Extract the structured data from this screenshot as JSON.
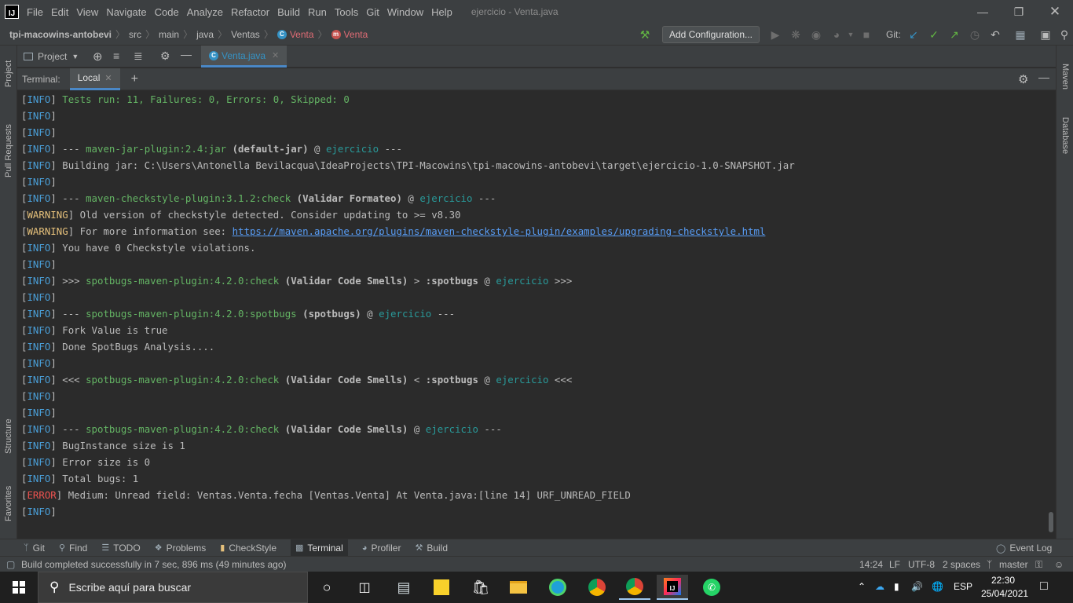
{
  "menubar": {
    "items": [
      "File",
      "Edit",
      "View",
      "Navigate",
      "Code",
      "Analyze",
      "Refactor",
      "Build",
      "Run",
      "Tools",
      "Git",
      "Window",
      "Help"
    ],
    "window_title": "ejercicio - Venta.java"
  },
  "breadcrumb": {
    "project": "tpi-macowins-antobevi",
    "parts": [
      "src",
      "main",
      "java",
      "Ventas"
    ],
    "class_name": "Venta",
    "method_name": "Venta"
  },
  "toolbar": {
    "add_configuration": "Add Configuration...",
    "git_label": "Git:"
  },
  "left_stripe": {
    "project": "Project",
    "pull_requests": "Pull Requests",
    "structure": "Structure",
    "favorites": "Favorites"
  },
  "right_stripe": {
    "maven": "Maven",
    "database": "Database"
  },
  "project_panel": {
    "label": "Project"
  },
  "editor": {
    "tab_label": "Venta.java"
  },
  "terminal": {
    "label": "Terminal:",
    "tab": "Local",
    "lines": [
      {
        "lvl": "INFO",
        "parts": [
          {
            "t": " "
          },
          {
            "t": "Tests run: 11, Failures: 0, Errors: 0, Skipped: 0",
            "c": "green"
          }
        ]
      },
      {
        "lvl": "INFO",
        "parts": []
      },
      {
        "lvl": "INFO",
        "parts": []
      },
      {
        "lvl": "INFO",
        "parts": [
          {
            "t": " --- "
          },
          {
            "t": "maven-jar-plugin:2.4:jar",
            "c": "green"
          },
          {
            "t": " (default-jar)",
            "c": "bold"
          },
          {
            "t": " @ "
          },
          {
            "t": "ejercicio",
            "c": "cyan"
          },
          {
            "t": " ---"
          }
        ]
      },
      {
        "lvl": "INFO",
        "parts": [
          {
            "t": " Building jar: C:\\Users\\Antonella Bevilacqua\\IdeaProjects\\TPI-Macowins\\tpi-macowins-antobevi\\target\\ejercicio-1.0-SNAPSHOT.jar"
          }
        ]
      },
      {
        "lvl": "INFO",
        "parts": []
      },
      {
        "lvl": "INFO",
        "parts": [
          {
            "t": " --- "
          },
          {
            "t": "maven-checkstyle-plugin:3.1.2:check",
            "c": "green"
          },
          {
            "t": " (Validar Formateo)",
            "c": "bold"
          },
          {
            "t": " @ "
          },
          {
            "t": "ejercicio",
            "c": "cyan"
          },
          {
            "t": " ---"
          }
        ]
      },
      {
        "lvl": "WARNING",
        "parts": [
          {
            "t": " Old version of checkstyle detected. Consider updating to >= v8.30"
          }
        ]
      },
      {
        "lvl": "WARNING",
        "parts": [
          {
            "t": " For more information see: "
          },
          {
            "t": "https://maven.apache.org/plugins/maven-checkstyle-plugin/examples/upgrading-checkstyle.html",
            "c": "link"
          }
        ]
      },
      {
        "lvl": "INFO",
        "parts": [
          {
            "t": " You have 0 Checkstyle violations."
          }
        ]
      },
      {
        "lvl": "INFO",
        "parts": []
      },
      {
        "lvl": "INFO",
        "parts": [
          {
            "t": " >>> "
          },
          {
            "t": "spotbugs-maven-plugin:4.2.0:check",
            "c": "green"
          },
          {
            "t": " (Validar Code Smells)",
            "c": "bold"
          },
          {
            "t": " > "
          },
          {
            "t": ":spotbugs",
            "c": "bold"
          },
          {
            "t": " @ "
          },
          {
            "t": "ejercicio",
            "c": "cyan"
          },
          {
            "t": " >>>"
          }
        ]
      },
      {
        "lvl": "INFO",
        "parts": []
      },
      {
        "lvl": "INFO",
        "parts": [
          {
            "t": " --- "
          },
          {
            "t": "spotbugs-maven-plugin:4.2.0:spotbugs",
            "c": "green"
          },
          {
            "t": " (spotbugs)",
            "c": "bold"
          },
          {
            "t": " @ "
          },
          {
            "t": "ejercicio",
            "c": "cyan"
          },
          {
            "t": " ---"
          }
        ]
      },
      {
        "lvl": "INFO",
        "parts": [
          {
            "t": " Fork Value is true"
          }
        ]
      },
      {
        "lvl": "INFO",
        "parts": [
          {
            "t": " Done SpotBugs Analysis...."
          }
        ]
      },
      {
        "lvl": "INFO",
        "parts": []
      },
      {
        "lvl": "INFO",
        "parts": [
          {
            "t": " <<< "
          },
          {
            "t": "spotbugs-maven-plugin:4.2.0:check",
            "c": "green"
          },
          {
            "t": " (Validar Code Smells)",
            "c": "bold"
          },
          {
            "t": " < "
          },
          {
            "t": ":spotbugs",
            "c": "bold"
          },
          {
            "t": " @ "
          },
          {
            "t": "ejercicio",
            "c": "cyan"
          },
          {
            "t": " <<<"
          }
        ]
      },
      {
        "lvl": "INFO",
        "parts": []
      },
      {
        "lvl": "INFO",
        "parts": []
      },
      {
        "lvl": "INFO",
        "parts": [
          {
            "t": " --- "
          },
          {
            "t": "spotbugs-maven-plugin:4.2.0:check",
            "c": "green"
          },
          {
            "t": " (Validar Code Smells)",
            "c": "bold"
          },
          {
            "t": " @ "
          },
          {
            "t": "ejercicio",
            "c": "cyan"
          },
          {
            "t": " ---"
          }
        ]
      },
      {
        "lvl": "INFO",
        "parts": [
          {
            "t": " BugInstance size is 1"
          }
        ]
      },
      {
        "lvl": "INFO",
        "parts": [
          {
            "t": " Error size is 0"
          }
        ]
      },
      {
        "lvl": "INFO",
        "parts": [
          {
            "t": " Total bugs: 1"
          }
        ]
      },
      {
        "lvl": "ERROR",
        "parts": [
          {
            "t": " Medium: Unread field: Ventas.Venta.fecha [Ventas.Venta] At Venta.java:[line 14] URF_UNREAD_FIELD"
          }
        ]
      },
      {
        "lvl": "INFO",
        "parts": []
      }
    ]
  },
  "bottom_tabs": [
    "Git",
    "Find",
    "TODO",
    "Problems",
    "CheckStyle",
    "Terminal",
    "Profiler",
    "Build"
  ],
  "bottom_tab_icons": [
    "git-icon",
    "search-icon",
    "list-icon",
    "problems-icon",
    "checkstyle-icon",
    "terminal-icon",
    "profiler-icon",
    "hammer-icon"
  ],
  "event_log": "Event Log",
  "status": {
    "message": "Build completed successfully in 7 sec, 896 ms (49 minutes ago)",
    "position": "14:24",
    "line_sep": "LF",
    "encoding": "UTF-8",
    "indent": "2 spaces",
    "branch": "master"
  },
  "taskbar": {
    "search_placeholder": "Escribe aquí para buscar",
    "lang": "ESP",
    "time": "22:30",
    "date": "25/04/2021"
  },
  "colors": {
    "background": "#2b2b2b",
    "panel": "#3c3f41",
    "info": "#4a9fd8",
    "warning": "#e5c07b",
    "error": "#ef5350",
    "green": "#64b464",
    "cyan": "#299999",
    "link": "#589df6"
  }
}
